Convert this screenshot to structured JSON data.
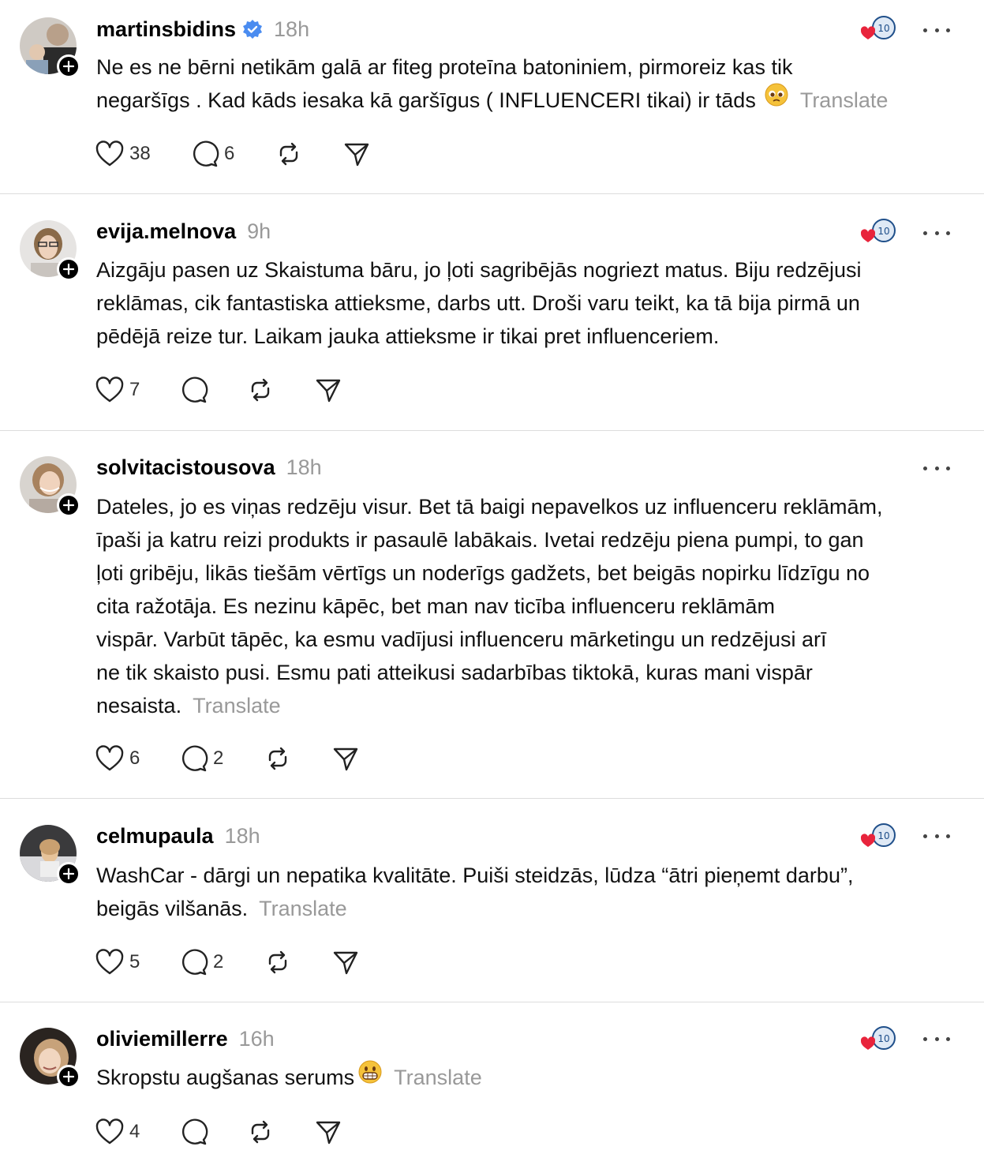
{
  "posts": [
    {
      "username": "martinsbidins",
      "verified": true,
      "time": "18h",
      "lines": [
        "Ne es ne bērni netikām galā ar fiteg proteīna batoniniem, pirmoreiz kas tik",
        "negaršīgs . Kad kāds iesaka kā garšīgus ( INFLUENCERI tikai) ir tāds"
      ],
      "emoji": "pleading-face",
      "translate": "Translate",
      "likes": "38",
      "comments": "6",
      "badge": true
    },
    {
      "username": "evija.melnova",
      "verified": false,
      "time": "9h",
      "lines": [
        "Aizgāju pasen uz Skaistuma bāru, jo ļoti sagribējās nogriezt matus. Biju redzējusi",
        "reklāmas, cik fantastiska attieksme, darbs utt. Droši varu teikt, ka tā bija pirmā un",
        "pēdējā reize tur. Laikam jauka attieksme ir tikai pret influenceriem."
      ],
      "translate": "",
      "likes": "7",
      "comments": "",
      "badge": true
    },
    {
      "username": "solvitacistousova",
      "verified": false,
      "time": "18h",
      "lines": [
        "Dateles, jo es viņas redzēju visur. Bet tā baigi nepavelkos uz influenceru reklāmām,",
        "īpaši ja katru reizi produkts ir pasaulē labākais. Ivetai redzēju piena pumpi, to gan",
        "ļoti gribēju, likās tiešām vērtīgs un noderīgs gadžets, bet beigās nopirku līdzīgu no",
        "cita ražotāja. Es nezinu kāpēc, bet man nav ticība influenceru reklāmām",
        "vispār. Varbūt tāpēc, ka esmu vadījusi influenceru mārketingu un redzējusi arī",
        "ne tik skaisto pusi. Esmu pati atteikusi sadarbības tiktokā, kuras mani vispār",
        "nesaista."
      ],
      "translate": "Translate",
      "likes": "6",
      "comments": "2",
      "badge": false
    },
    {
      "username": "celmupaula",
      "verified": false,
      "time": "18h",
      "lines": [
        "WashCar - dārgi un nepatika kvalitāte. Puiši steidzās, lūdza “ātri pieņemt darbu”,",
        "beigās vilšanās."
      ],
      "translate": "Translate",
      "likes": "5",
      "comments": "2",
      "badge": true
    },
    {
      "username": "oliviemillerre",
      "verified": false,
      "time": "16h",
      "lines": [
        "Skropstu augšanas serums"
      ],
      "emoji": "grinning-face",
      "translate": "Translate",
      "likes": "4",
      "comments": "",
      "badge": true
    }
  ],
  "colors": {
    "text": "#111111",
    "muted": "#999999",
    "verified": "#4a8cf0",
    "divider": "#dcdcdc",
    "heart": "#e8243c"
  },
  "icons": [
    "heart-icon",
    "comment-icon",
    "repost-icon",
    "share-icon",
    "more-icon",
    "verified-icon",
    "follow-plus-icon"
  ]
}
